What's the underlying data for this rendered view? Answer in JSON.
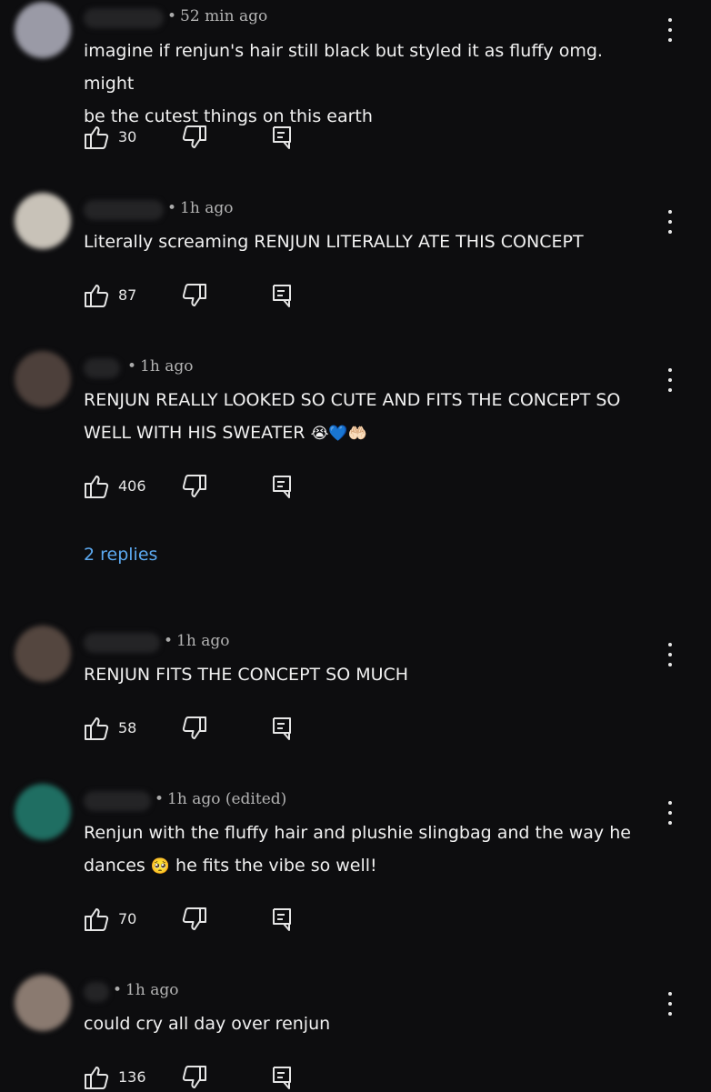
{
  "comments": [
    {
      "time": "52 min ago",
      "lines": [
        "imagine if renjun's hair still black but styled it as fluffy omg. might",
        "be the cutest things on this earth"
      ],
      "likes": "30",
      "avatar_color": "#9a9aa6"
    },
    {
      "time": "1h ago",
      "lines": [
        "Literally screaming RENJUN LITERALLY ATE THIS CONCEPT"
      ],
      "likes": "87",
      "avatar_color": "#c8c2b8"
    },
    {
      "time": "1h ago",
      "lines": [
        "RENJUN REALLY LOOKED SO CUTE AND FITS THE CONCEPT SO",
        "WELL WITH HIS SWEATER"
      ],
      "emoji": "😭💙🤲🏻",
      "likes": "406",
      "replies": "2 replies",
      "avatar_color": "#4d403b"
    },
    {
      "time": "1h ago",
      "lines": [
        "RENJUN FITS THE CONCEPT SO MUCH"
      ],
      "likes": "58",
      "avatar_color": "#54463f"
    },
    {
      "time": "1h ago (edited)",
      "lines": [
        "Renjun with the fluffy hair and plushie slingbag and the way he",
        "dances"
      ],
      "emoji": "🥺",
      "line2_after": " he fits the vibe so well!",
      "likes": "70",
      "avatar_color": "#1f6e62"
    },
    {
      "time": "1h ago",
      "lines": [
        "could cry all day over renjun"
      ],
      "likes": "136",
      "avatar_color": "#8a7a70"
    }
  ],
  "icons": {
    "like": "thumbs-up-icon",
    "dislike": "thumbs-down-icon",
    "reply": "comment-reply-icon",
    "more": "more-vertical-icon"
  },
  "colors": {
    "background": "#0d0d0f",
    "text": "#f1f1f1",
    "meta": "#b3b3b3",
    "link": "#5ca9f0"
  }
}
